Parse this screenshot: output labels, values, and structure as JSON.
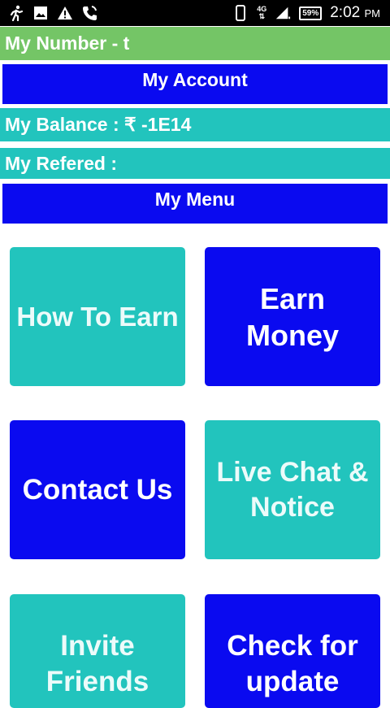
{
  "status_bar": {
    "icons_left": [
      "run-icon",
      "image-icon",
      "warning-icon",
      "phone-call-icon"
    ],
    "icons_right": [
      "phone-device-icon",
      "network-4g-icon",
      "signal-icon",
      "battery-icon"
    ],
    "network_label": "4G",
    "battery": "59%",
    "time": "2:02",
    "ampm": "PM"
  },
  "header": {
    "number_label": "My Number -  t",
    "account_label": "My Account",
    "balance_label": "My Balance : ₹ -1E14",
    "refered_label": "My Refered :",
    "menu_label": "My Menu"
  },
  "menu": {
    "how_to_earn": "How To Earn",
    "earn_money": "Earn Money",
    "contact_us": "Contact Us",
    "live_chat": "Live Chat & Notice",
    "invite_friends": "Invite Friends",
    "check_update": "Check for update"
  },
  "colors": {
    "green": "#74c566",
    "blue": "#0a0af0",
    "teal": "#22c4bd"
  }
}
